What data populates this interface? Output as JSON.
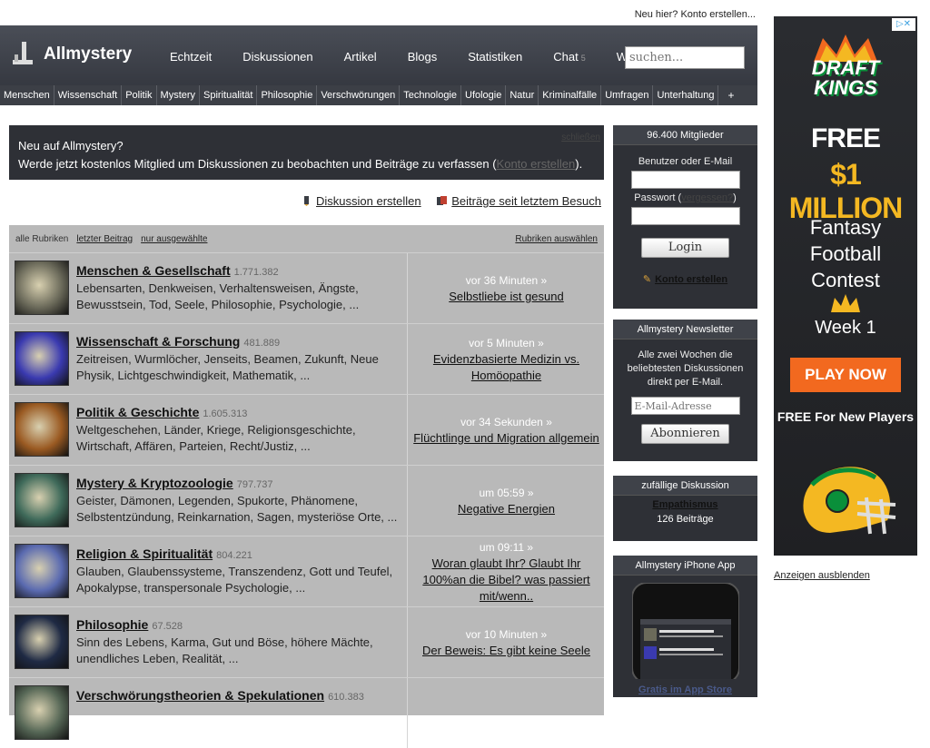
{
  "top": {
    "signup_text": "Neu hier? Konto erstellen..."
  },
  "header": {
    "logo": "Allmystery",
    "nav": [
      {
        "label": "Echtzeit"
      },
      {
        "label": "Diskussionen"
      },
      {
        "label": "Artikel"
      },
      {
        "label": "Blogs"
      },
      {
        "label": "Statistiken"
      },
      {
        "label": "Chat",
        "count": "5"
      },
      {
        "label": "Wiki"
      }
    ],
    "search_placeholder": "suchen..."
  },
  "categories": [
    "Menschen",
    "Wissenschaft",
    "Politik",
    "Mystery",
    "Spiritualität",
    "Philosophie",
    "Verschwörungen",
    "Technologie",
    "Ufologie",
    "Natur",
    "Kriminalfälle",
    "Umfragen",
    "Unterhaltung",
    "+"
  ],
  "notice": {
    "line1": "Neu auf Allmystery?",
    "line2_pre": "Werde jetzt kostenlos Mitglied um Diskussionen zu beobachten und Beiträge zu verfassen (",
    "line2_link": "Konto erstellen",
    "line2_post": ").",
    "close": "schließen"
  },
  "actions": {
    "create": "Diskussion erstellen",
    "since_last": "Beiträge seit letztem Besuch"
  },
  "forum_header": {
    "all": "alle Rubriken",
    "last_post": "letzter Beitrag",
    "selected": "nur ausgewählte",
    "choose": "Rubriken auswählen"
  },
  "forums": [
    {
      "title": "Menschen & Gesellschaft",
      "count": "1.771.382",
      "desc": "Lebensarten, Denkweisen, Verhaltensweisen, Ängste, Bewusstsein, Tod, Seele, Philosophie, Psychologie, ...",
      "time": "vor 36 Minuten »",
      "topic": "Selbstliebe ist gesund",
      "thumb_color": "#6b6a5a"
    },
    {
      "title": "Wissenschaft & Forschung",
      "count": "481.889",
      "desc": "Zeitreisen, Wurmlöcher, Jenseits, Beamen, Zukunft, Neue Physik, Lichtgeschwindigkeit, Mathematik, ...",
      "time": "vor 5 Minuten »",
      "topic": "Evidenzbasierte Medizin vs. Homöopathie",
      "thumb_color": "#3a3ab0"
    },
    {
      "title": "Politik & Geschichte",
      "count": "1.605.313",
      "desc": "Weltgeschehen, Länder, Kriege, Religionsgeschichte, Wirtschaft, Affären, Parteien, Recht/Justiz, ...",
      "time": "vor 34 Sekunden »",
      "topic": "Flüchtlinge und Migration allgemein",
      "thumb_color": "#9a5a22"
    },
    {
      "title": "Mystery & Kryptozoologie",
      "count": "797.737",
      "desc": "Geister, Dämonen, Legenden, Spukorte, Phänomene, Selbstentzündung, Reinkarnation, Sagen, mysteriöse Orte, ...",
      "time": "um 05:59 »",
      "topic": "Negative Energien",
      "thumb_color": "#3f6a5a"
    },
    {
      "title": "Religion & Spiritualität",
      "count": "804.221",
      "desc": "Glauben, Glaubenssysteme, Transzendenz, Gott und Teufel, Apokalypse, transpersonale Psychologie, ...",
      "time": "um 09:11 »",
      "topic": "Woran glaubt Ihr? Glaubt Ihr 100%an die Bibel? was passiert mit/wenn..",
      "thumb_color": "#5a6ab0"
    },
    {
      "title": "Philosophie",
      "count": "67.528",
      "desc": "Sinn des Lebens, Karma, Gut und Böse, höhere Mächte, unendliches Leben, Realität, ...",
      "time": "vor 10 Minuten »",
      "topic": "Der Beweis: Es gibt keine Seele",
      "thumb_color": "#1f2a44"
    },
    {
      "title": "Verschwörungstheorien & Spekulationen",
      "count": "610.383",
      "desc": "",
      "time": "",
      "topic": "",
      "thumb_color": "#556655"
    }
  ],
  "login": {
    "members": "96.400 Mitglieder",
    "user_label": "Benutzer oder E-Mail",
    "pass_label_pre": "Passwort (",
    "pass_forgot": "vergessen?",
    "pass_label_post": ")",
    "button": "Login",
    "create": "Konto erstellen"
  },
  "newsletter": {
    "title": "Allmystery Newsletter",
    "text": "Alle zwei Wochen die beliebtesten Diskussionen direkt per E-Mail.",
    "placeholder": "E-Mail-Adresse",
    "button": "Abonnieren"
  },
  "random": {
    "title": "zufällige Diskussion",
    "topic": "Empathismus",
    "posts": "126 Beiträge"
  },
  "app": {
    "title": "Allmystery iPhone App",
    "link": "Gratis im App Store"
  },
  "ad": {
    "brand_line1": "DRAFT",
    "brand_line2": "KINGS",
    "free": "FREE",
    "million": "$1 MILLION",
    "contest": "Fantasy Football Contest",
    "week": "Week 1",
    "play": "PLAY NOW",
    "new_players": "FREE For New Players",
    "hide": "Anzeigen ausblenden"
  },
  "colors": {
    "header_bg": "#3a3d44",
    "list_bg": "#b9b9b9",
    "ad_orange": "#f2691f",
    "ad_gold": "#f4b822"
  }
}
